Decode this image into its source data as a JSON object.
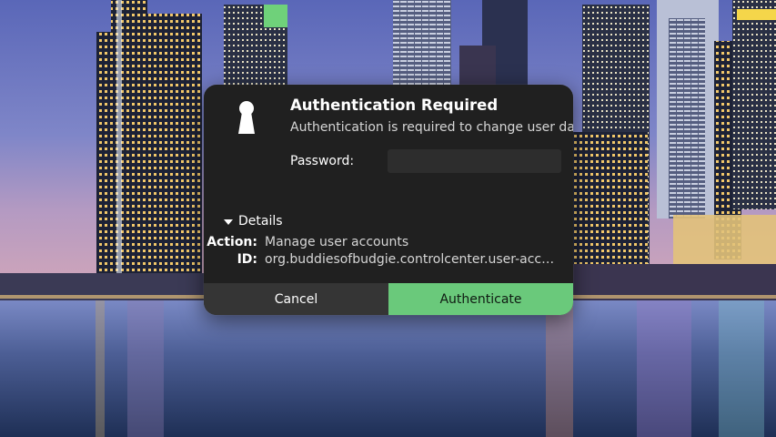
{
  "dialog": {
    "title": "Authentication Required",
    "message": "Authentication is required to change user data",
    "password_label": "Password:",
    "password_value": "",
    "details_toggle": "Details",
    "details": {
      "action_key": "Action:",
      "action_value": "Manage user accounts",
      "id_key": "ID:",
      "id_value": "org.buddiesofbudgie.controlcenter.user-accounts.administration"
    },
    "cancel_label": "Cancel",
    "authenticate_label": "Authenticate"
  },
  "colors": {
    "dialog_bg": "#202020",
    "authenticate_bg": "#6ac97b",
    "cancel_bg": "#353535",
    "input_bg": "#2d2d2d"
  },
  "icons": {
    "lock": "keyhole-icon",
    "expander": "triangle-down-icon"
  }
}
